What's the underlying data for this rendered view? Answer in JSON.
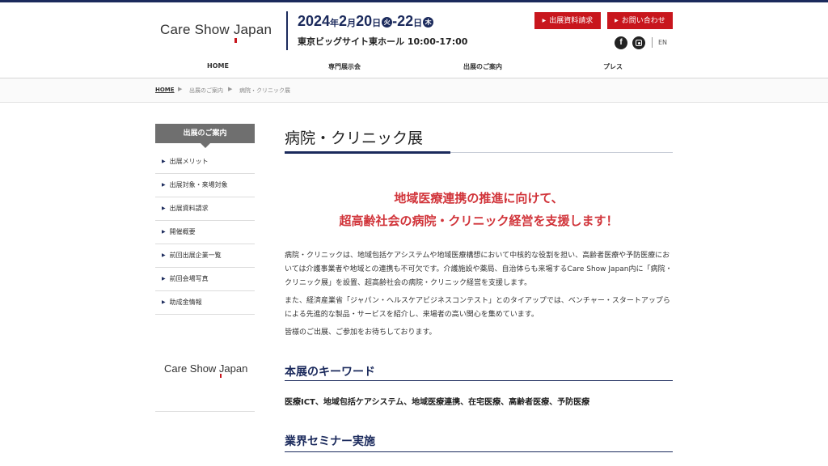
{
  "header": {
    "logo": {
      "pre": "Care Show ",
      "j": "J",
      "post": "apan"
    },
    "date": {
      "year": "2024",
      "year_unit": "年",
      "month": "2",
      "month_unit": "月",
      "day1": "20",
      "day_unit": "日",
      "dow1": "火",
      "sep": "-",
      "day2": "22",
      "dow2": "木"
    },
    "venue": "東京ビッグサイト東ホール 10:00-17:00",
    "buttons": {
      "apply": "出展資料請求",
      "contact": "お問い合わせ",
      "arrow": "▶"
    },
    "sns": {
      "facebook": "f"
    },
    "lang": "EN"
  },
  "nav": [
    "HOME",
    "専門展示会",
    "出展のご案内",
    "プレス"
  ],
  "breadcrumb": [
    "HOME",
    "出展のご案内",
    "病院・クリニック展"
  ],
  "breadcrumb_sep": "▶",
  "sidebar": {
    "heading": "出展のご案内",
    "bullet": "▶",
    "items": [
      "出展メリット",
      "出展対象・来場対象",
      "出展資料請求",
      "開催概要",
      "前回出展企業一覧",
      "前回会場写真",
      "助成金情報"
    ],
    "logo": {
      "pre": "Care Show ",
      "j": "J",
      "post": "apan"
    }
  },
  "main": {
    "title": "病院・クリニック展",
    "catch": [
      "地域医療連携の推進に向けて、",
      "超高齢社会の病院・クリニック経営を支援します！"
    ],
    "paragraphs": [
      "病院・クリニックは、地域包括ケアシステムや地域医療構想において中核的な役割を担い、高齢者医療や予防医療においては介護事業者や地域との連携も不可欠です。介護施設や薬局、自治体らも来場するCare Show Japan内に「病院・クリニック展」を設置、超高齢社会の病院・クリニック経営を支援します。",
      "また、経済産業省「ジャパン・ヘルスケアビジネスコンテスト」とのタイアップでは、ベンチャー・スタートアップらによる先進的な製品・サービスを紹介し、来場者の高い関心を集めています。",
      "皆様のご出展、ご参加をお待ちしております。"
    ],
    "section1": "本展のキーワード",
    "keywords": "医療ICT、地域包括ケアシステム、地域医療連携、在宅医療、高齢者医療、予防医療",
    "section2": "業界セミナー実施"
  }
}
